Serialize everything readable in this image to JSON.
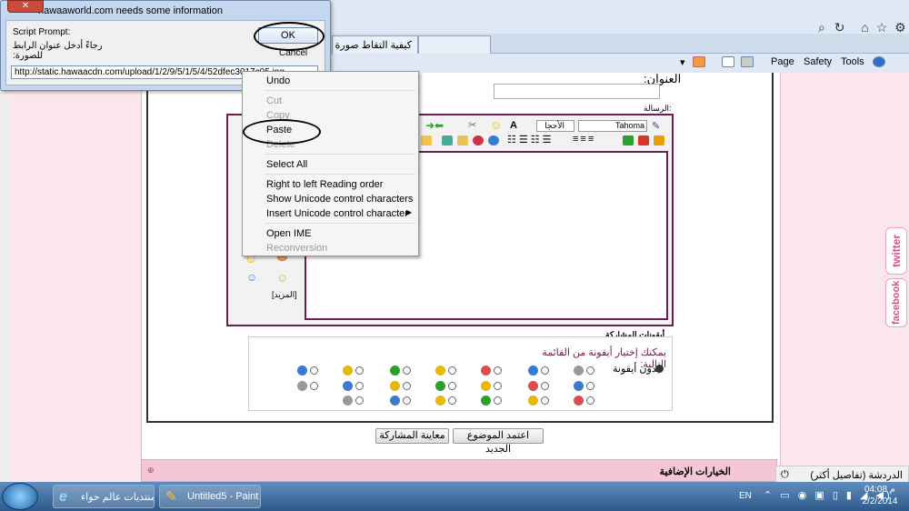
{
  "browser": {
    "tabs": [
      "كيفية التقاط صورة م...",
      ""
    ],
    "commands": {
      "page": "Page",
      "safety": "Safety",
      "tools": "Tools"
    }
  },
  "dialog": {
    "title": "hawaaworld.com needs some information",
    "prompt_label": "Script Prompt:",
    "prompt_text": "رجاءً أدخل عنوان الرابط للصورة:",
    "ok": "OK",
    "cancel": "Cancel",
    "url_value": "http://static.hawaacdn.com/upload/1/2/9/5/1/5/4/52dfec3017c05.jpg"
  },
  "context_menu": {
    "items": [
      {
        "label": "Undo",
        "enabled": true
      },
      {
        "label": "Cut",
        "enabled": false
      },
      {
        "label": "Copy",
        "enabled": false
      },
      {
        "label": "Paste",
        "enabled": true
      },
      {
        "label": "Delete",
        "enabled": false
      },
      {
        "label": "Select All",
        "enabled": true
      },
      {
        "label": "Right to left Reading order",
        "enabled": true
      },
      {
        "label": "Show Unicode control characters",
        "enabled": true
      },
      {
        "label": "Insert Unicode control character",
        "enabled": true
      },
      {
        "label": "Open IME",
        "enabled": true
      },
      {
        "label": "Reconversion",
        "enabled": false
      }
    ]
  },
  "form": {
    "title_label": "العنوان:",
    "message_label": "الرسالة:",
    "font_name": "Tahoma",
    "font_size": "الأحجا",
    "more_smilies": "[المزيد]",
    "icons_section_title": "أيقونات المشاركة",
    "icons_hint": "يمكنك إختيار أيقونة من القائمة التالية:",
    "no_icon": "بدون أيقونة",
    "submit": "اعتمد الموضوع الجديد",
    "preview": "معاينة المشاركة",
    "additional_options": "الخيارات الإضافية"
  },
  "chat": "الدردشة (تفاصيل أكثر)",
  "social": {
    "twitter": "twitter",
    "facebook": "facebook"
  },
  "taskbar": {
    "items": [
      "منتديات عالم حواء - ...",
      "Untitled5 - Paint"
    ],
    "lang": "EN",
    "time": "04:08 م",
    "date": "2/2/2014"
  },
  "colors": {
    "accent": "#6b1f4e",
    "pink_bg": "#fce6ee"
  }
}
